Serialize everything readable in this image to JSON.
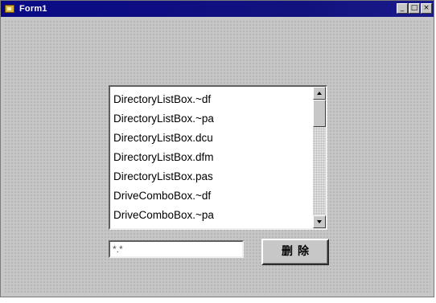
{
  "window": {
    "title": "Form1",
    "title_bar_color": "#12127e",
    "controls": {
      "minimize_icon": "minimize-icon",
      "maximize_icon": "maximize-icon",
      "close_icon": "close-icon"
    }
  },
  "listbox": {
    "items": [
      "DirectoryListBox.~df",
      "DirectoryListBox.~pa",
      "DirectoryListBox.dcu",
      "DirectoryListBox.dfm",
      "DirectoryListBox.pas",
      "DriveComboBox.~df",
      "DriveComboBox.~pa"
    ]
  },
  "input": {
    "value": "*.*"
  },
  "button": {
    "label": "删除"
  }
}
